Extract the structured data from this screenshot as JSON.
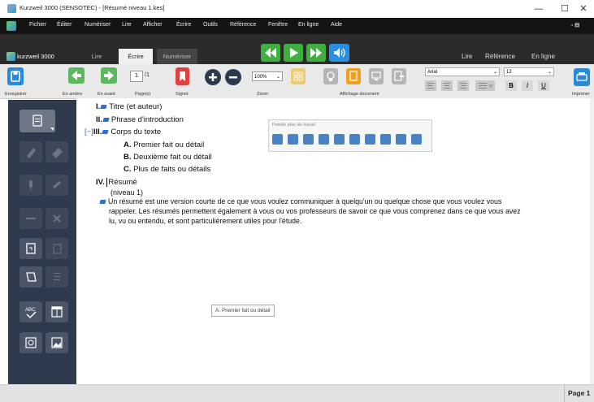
{
  "window": {
    "title": "Kurzweil 3000 (SENSOTEC) - [Résumé niveau 1.kes]",
    "minimize": "—",
    "maximize": "☐",
    "close": "✕"
  },
  "menubar": {
    "items": [
      "Fichier",
      "Éditer",
      "Numériser",
      "Lire",
      "Afficher",
      "Écrire",
      "Outils",
      "Référence",
      "Fenêtre",
      "En ligne",
      "Aide"
    ],
    "right_glyph": "- ⊟"
  },
  "tabs": {
    "logo": "kurzweil 3000",
    "items": [
      "Lire",
      "Écrire",
      "Numériser"
    ],
    "active": "Écrire",
    "right": [
      "Lire",
      "Référence",
      "En ligne"
    ]
  },
  "ribbon": {
    "save_label": "Enregistrer",
    "back_label": "En arrière",
    "forward_label": "En avant",
    "page_value": "1",
    "page_total": "/1",
    "pages_label": "Page(s)",
    "bookmark_label": "Signet",
    "zoom_value": "100%",
    "zoom_label": "Zoom",
    "doc_view_label": "Affichage document",
    "font_name": "Arial",
    "font_size": "12",
    "bold": "B",
    "italic": "I",
    "underline": "U",
    "print_label": "Imprimer"
  },
  "palette": {
    "title": "Palette plan de travail",
    "icon_count": 10
  },
  "outline": {
    "items": [
      {
        "num": "I.",
        "text": "Titre (et auteur)"
      },
      {
        "num": "II.",
        "text": "Phrase d'introduction"
      },
      {
        "num": "III.",
        "prefix": "[−]",
        "text": "Corps du texte"
      },
      {
        "num": "A.",
        "text": "Premier fait ou détail"
      },
      {
        "num": "B.",
        "text": "Deuxième fait ou détail"
      },
      {
        "num": "C.",
        "text": "Plus de faits ou détails"
      },
      {
        "num": "IV.",
        "text": "Résumé"
      }
    ],
    "level_note": "(niveau 1)",
    "paragraph_line1": "Un résumé est une version courte de ce que vous voulez communiquer à quelqu'un ou quelque chose que vous voulez vous",
    "paragraph_line2": "rappeler. Les résumés permettent également à vous ou vos professeurs de savoir ce que vous comprenez dans ce que vous avez",
    "paragraph_line3": "lu, vu ou entendu, et sont particulièrement utiles pour l'étude."
  },
  "tooltip": "A. Premier fait ou détail",
  "status": {
    "page": "Page 1"
  },
  "colors": {
    "accent_green": "#3fb040",
    "accent_blue": "#2b8fe0",
    "sidebar": "#2e3b4f",
    "bullet": "#2b6fd6"
  }
}
